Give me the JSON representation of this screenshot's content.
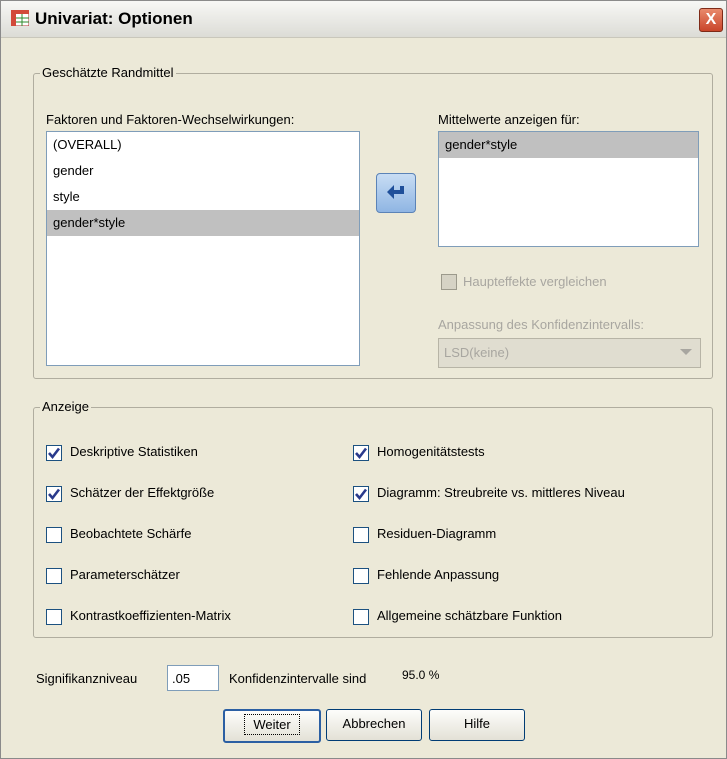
{
  "window": {
    "title": "Univariat: Optionen",
    "close": "X"
  },
  "margins_group": {
    "legend": "Geschätzte Randmittel",
    "factors_label": "Faktoren und Faktoren-Wechselwirkungen:",
    "factors": [
      "(OVERALL)",
      "gender",
      "style",
      "gender*style"
    ],
    "factors_selected": "gender*style",
    "means_label": "Mittelwerte anzeigen für:",
    "means": [
      "gender*style"
    ],
    "compare_main_effects": {
      "label": "Haupteffekte vergleichen",
      "checked": false,
      "enabled": false
    },
    "ci_adjust_label": "Anpassung des Konfidenzintervalls:",
    "ci_adjust_value": "LSD(keine)"
  },
  "display_group": {
    "legend": "Anzeige",
    "options": [
      {
        "label": "Deskriptive Statistiken",
        "checked": true
      },
      {
        "label": "Schätzer der Effektgröße",
        "checked": true
      },
      {
        "label": "Beobachtete Schärfe",
        "checked": false
      },
      {
        "label": "Parameterschätzer",
        "checked": false
      },
      {
        "label": "Kontrastkoeffizienten-Matrix",
        "checked": false
      },
      {
        "label": "Homogenitätstests",
        "checked": true
      },
      {
        "label": "Diagramm: Streubreite vs. mittleres Niveau",
        "checked": true
      },
      {
        "label": "Residuen-Diagramm",
        "checked": false
      },
      {
        "label": "Fehlende Anpassung",
        "checked": false
      },
      {
        "label": "Allgemeine schätzbare Funktion",
        "checked": false
      }
    ]
  },
  "significance": {
    "label": "Signifikanzniveau",
    "value": ".05",
    "ci_text": "Konfidenzintervalle sind",
    "ci_value": "95.0 %"
  },
  "buttons": {
    "continue": "Weiter",
    "cancel": "Abbrechen",
    "help": "Hilfe"
  },
  "colors": {
    "check": "#2a3a8c",
    "selection": "#c0c0c0",
    "close": "#c9452a"
  }
}
